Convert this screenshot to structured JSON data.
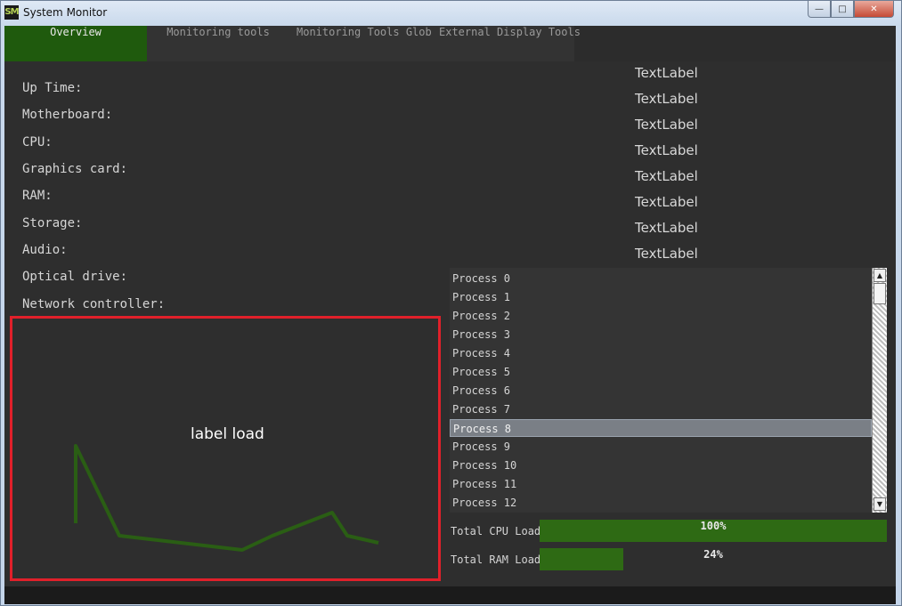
{
  "window": {
    "title": "System Monitor",
    "icon_text": "SM",
    "buttons": {
      "minimize": "—",
      "maximize": "□",
      "close": "✕"
    }
  },
  "tabs": [
    {
      "label": "Overview",
      "active": true
    },
    {
      "label": "Monitoring tools",
      "active": false
    },
    {
      "label": "Monitoring Tools Global",
      "active": false
    },
    {
      "label": "External Display Tools",
      "active": false
    }
  ],
  "overview": {
    "labels": [
      "Up Time:",
      "Motherboard:",
      "CPU:",
      "Graphics card:",
      "RAM:",
      "Storage:",
      "Audio:",
      "Optical drive:",
      "Network controller:"
    ],
    "values": [
      "TextLabel",
      "TextLabel",
      "TextLabel",
      "TextLabel",
      "TextLabel",
      "TextLabel",
      "TextLabel",
      "TextLabel"
    ]
  },
  "chart": {
    "label": "label load",
    "line_color": "#2a5e14",
    "border_color": "#e0202a"
  },
  "processes": {
    "items": [
      "Process 0",
      "Process 1",
      "Process 2",
      "Process 3",
      "Process 4",
      "Process 5",
      "Process 6",
      "Process 7",
      "Process 8",
      "Process 9",
      "Process 10",
      "Process 11",
      "Process 12"
    ],
    "selected_index": 8
  },
  "load": {
    "cpu": {
      "label": "Total CPU Load",
      "percent": 100,
      "text": "100%"
    },
    "ram": {
      "label": "Total RAM Load",
      "percent": 24,
      "text": "24%"
    }
  },
  "colors": {
    "active_tab": "#1f5a0d",
    "bar_fill": "#2e6a14",
    "background": "#2e2e2e"
  }
}
